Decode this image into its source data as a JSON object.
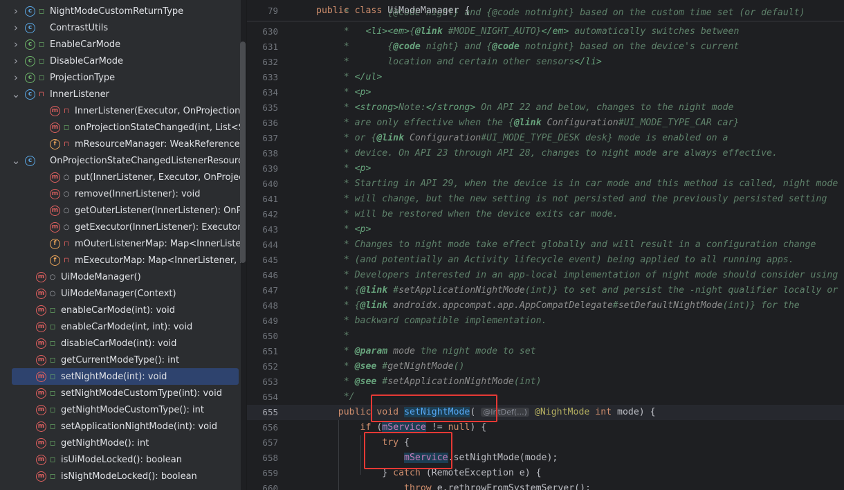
{
  "structure": {
    "items": [
      {
        "indent": 1,
        "toggle": "›",
        "icon": "c",
        "vis": "pub",
        "label": "NightModeCustomReturnType",
        "icon_name": "annotation-type-icon"
      },
      {
        "indent": 1,
        "toggle": "›",
        "icon": "c",
        "vis": "",
        "label": "ContrastUtils",
        "icon_name": "class-icon"
      },
      {
        "indent": 1,
        "toggle": "›",
        "icon": "e",
        "vis": "pub",
        "label": "EnableCarMode",
        "icon_name": "annotation-type-icon"
      },
      {
        "indent": 1,
        "toggle": "›",
        "icon": "e",
        "vis": "pub",
        "label": "DisableCarMode",
        "icon_name": "annotation-type-icon"
      },
      {
        "indent": 1,
        "toggle": "›",
        "icon": "e",
        "vis": "pub",
        "label": "ProjectionType",
        "icon_name": "annotation-type-icon"
      },
      {
        "indent": 1,
        "toggle": "⌄",
        "icon": "c",
        "vis": "priv",
        "label": "InnerListener",
        "icon_name": "class-icon"
      },
      {
        "indent": 3,
        "toggle": "",
        "icon": "m",
        "vis": "priv",
        "label": "InnerListener(Executor, OnProjectionStateC",
        "icon_name": "method-icon"
      },
      {
        "indent": 3,
        "toggle": "",
        "icon": "m",
        "vis": "pub",
        "label": "onProjectionStateChanged(int, List<String>",
        "icon_name": "method-icon"
      },
      {
        "indent": 3,
        "toggle": "",
        "icon": "f",
        "vis": "priv",
        "label": "mResourceManager: WeakReference<OnP",
        "icon_name": "field-icon"
      },
      {
        "indent": 1,
        "toggle": "⌄",
        "icon": "c",
        "vis": "",
        "label": "OnProjectionStateChangedListenerResourceM",
        "icon_name": "class-icon"
      },
      {
        "indent": 3,
        "toggle": "",
        "icon": "m",
        "vis": "pkg",
        "label": "put(InnerListener, Executor, OnProjectionSt",
        "icon_name": "method-icon"
      },
      {
        "indent": 3,
        "toggle": "",
        "icon": "m",
        "vis": "pkg",
        "label": "remove(InnerListener): void",
        "icon_name": "method-icon"
      },
      {
        "indent": 3,
        "toggle": "",
        "icon": "m",
        "vis": "pkg",
        "label": "getOuterListener(InnerListener): OnProjecti",
        "icon_name": "method-icon"
      },
      {
        "indent": 3,
        "toggle": "",
        "icon": "m",
        "vis": "pkg",
        "label": "getExecutor(InnerListener): Executor",
        "icon_name": "method-icon"
      },
      {
        "indent": 3,
        "toggle": "",
        "icon": "f",
        "vis": "priv",
        "label": "mOuterListenerMap: Map<InnerListener, C",
        "icon_name": "field-icon"
      },
      {
        "indent": 3,
        "toggle": "",
        "icon": "f",
        "vis": "priv",
        "label": "mExecutorMap: Map<InnerListener, Execu",
        "icon_name": "field-icon"
      },
      {
        "indent": 2,
        "toggle": "",
        "icon": "m",
        "vis": "pkg",
        "label": "UiModeManager()",
        "icon_name": "method-icon"
      },
      {
        "indent": 2,
        "toggle": "",
        "icon": "m",
        "vis": "pkg",
        "label": "UiModeManager(Context)",
        "icon_name": "method-icon"
      },
      {
        "indent": 2,
        "toggle": "",
        "icon": "m",
        "vis": "pub",
        "label": "enableCarMode(int): void",
        "icon_name": "method-icon"
      },
      {
        "indent": 2,
        "toggle": "",
        "icon": "m",
        "vis": "pub",
        "label": "enableCarMode(int, int): void",
        "icon_name": "method-icon"
      },
      {
        "indent": 2,
        "toggle": "",
        "icon": "m",
        "vis": "pub",
        "label": "disableCarMode(int): void",
        "icon_name": "method-icon"
      },
      {
        "indent": 2,
        "toggle": "",
        "icon": "m",
        "vis": "pub",
        "label": "getCurrentModeType(): int",
        "icon_name": "method-icon"
      },
      {
        "indent": 2,
        "toggle": "",
        "icon": "m",
        "vis": "pub",
        "label": "setNightMode(int): void",
        "icon_name": "method-icon",
        "selected": true
      },
      {
        "indent": 2,
        "toggle": "",
        "icon": "m",
        "vis": "pub",
        "label": "setNightModeCustomType(int): void",
        "icon_name": "method-icon"
      },
      {
        "indent": 2,
        "toggle": "",
        "icon": "m",
        "vis": "pub",
        "label": "getNightModeCustomType(): int",
        "icon_name": "method-icon"
      },
      {
        "indent": 2,
        "toggle": "",
        "icon": "m",
        "vis": "pub",
        "label": "setApplicationNightMode(int): void",
        "icon_name": "method-icon"
      },
      {
        "indent": 2,
        "toggle": "",
        "icon": "m",
        "vis": "pub",
        "label": "getNightMode(): int",
        "icon_name": "method-icon"
      },
      {
        "indent": 2,
        "toggle": "",
        "icon": "m",
        "vis": "pub",
        "label": "isUiModeLocked(): boolean",
        "icon_name": "method-icon"
      },
      {
        "indent": 2,
        "toggle": "",
        "icon": "m",
        "vis": "pub",
        "label": "isNightModeLocked(): boolean",
        "icon_name": "method-icon"
      }
    ]
  },
  "editor": {
    "sticky": {
      "line": "79",
      "keyword1": "public",
      "keyword2": "class",
      "name": "UiModeManager",
      "brace": "{"
    },
    "lines": [
      {
        "n": "630",
        "segs": [
          [
            "c",
            "     *   "
          ],
          [
            "ct",
            "<li><em>"
          ],
          [
            "c",
            "{"
          ],
          [
            "cb",
            "@link"
          ],
          [
            "c",
            " #MODE_NIGHT_AUTO}"
          ],
          [
            "ct",
            "</em>"
          ],
          [
            "c",
            " automatically switches between"
          ]
        ]
      },
      {
        "n": "631",
        "segs": [
          [
            "c",
            "     *       {"
          ],
          [
            "cb",
            "@code"
          ],
          [
            "c",
            " night} and {"
          ],
          [
            "cb",
            "@code"
          ],
          [
            "c",
            " notnight} based on the device's current"
          ]
        ]
      },
      {
        "n": "632",
        "segs": [
          [
            "c",
            "     *       location and certain other sensors"
          ],
          [
            "ct",
            "</li>"
          ]
        ]
      },
      {
        "n": "633",
        "segs": [
          [
            "c",
            "     * "
          ],
          [
            "ct",
            "</ul>"
          ]
        ]
      },
      {
        "n": "634",
        "segs": [
          [
            "c",
            "     * "
          ],
          [
            "ct",
            "<p>"
          ]
        ]
      },
      {
        "n": "635",
        "segs": [
          [
            "c",
            "     * "
          ],
          [
            "ct",
            "<strong>"
          ],
          [
            "c",
            "Note:"
          ],
          [
            "ct",
            "</strong>"
          ],
          [
            "c",
            " On API 22 and below, changes to the night mode"
          ]
        ]
      },
      {
        "n": "636",
        "segs": [
          [
            "c",
            "     * are only effective when the {"
          ],
          [
            "cb",
            "@link"
          ],
          [
            "cl",
            " Configuration"
          ],
          [
            "c",
            "#UI_MODE_TYPE_CAR car}"
          ]
        ]
      },
      {
        "n": "637",
        "segs": [
          [
            "c",
            "     * or {"
          ],
          [
            "cb",
            "@link"
          ],
          [
            "cl",
            " Configuration"
          ],
          [
            "c",
            "#UI_MODE_TYPE_DESK desk} mode is enabled on a"
          ]
        ]
      },
      {
        "n": "638",
        "segs": [
          [
            "c",
            "     * device. On API 23 through API 28, changes to night mode are always effective."
          ]
        ]
      },
      {
        "n": "639",
        "segs": [
          [
            "c",
            "     * "
          ],
          [
            "ct",
            "<p>"
          ]
        ]
      },
      {
        "n": "640",
        "segs": [
          [
            "c",
            "     * Starting in API 29, when the device is in car mode and this method is called, night mode"
          ]
        ]
      },
      {
        "n": "641",
        "segs": [
          [
            "c",
            "     * will change, but the new setting is not persisted and the previously persisted setting"
          ]
        ]
      },
      {
        "n": "642",
        "segs": [
          [
            "c",
            "     * will be restored when the device exits car mode."
          ]
        ]
      },
      {
        "n": "643",
        "segs": [
          [
            "c",
            "     * "
          ],
          [
            "ct",
            "<p>"
          ]
        ]
      },
      {
        "n": "644",
        "segs": [
          [
            "c",
            "     * Changes to night mode take effect globally and will result in a configuration change"
          ]
        ]
      },
      {
        "n": "645",
        "segs": [
          [
            "c",
            "     * (and potentially an Activity lifecycle event) being applied to all running apps."
          ]
        ]
      },
      {
        "n": "646",
        "segs": [
          [
            "c",
            "     * Developers interested in an app-local implementation of night mode should consider using"
          ]
        ]
      },
      {
        "n": "647",
        "segs": [
          [
            "c",
            "     * {"
          ],
          [
            "cb",
            "@link"
          ],
          [
            "c",
            " #"
          ],
          [
            "cl",
            "setApplicationNightMode"
          ],
          [
            "c",
            "(int)} to set and persist the -night qualifier locally or"
          ]
        ]
      },
      {
        "n": "648",
        "segs": [
          [
            "c",
            "     * {"
          ],
          [
            "cb",
            "@link"
          ],
          [
            "cl",
            " androidx.appcompat.app.AppCompatDelegate"
          ],
          [
            "c",
            "#"
          ],
          [
            "cl",
            "setDefaultNightMode"
          ],
          [
            "c",
            "(int)} for the"
          ]
        ]
      },
      {
        "n": "649",
        "segs": [
          [
            "c",
            "     * backward compatible implementation."
          ]
        ]
      },
      {
        "n": "650",
        "segs": [
          [
            "c",
            "     *"
          ]
        ]
      },
      {
        "n": "651",
        "segs": [
          [
            "c",
            "     * "
          ],
          [
            "cb",
            "@param"
          ],
          [
            "cl",
            " mode"
          ],
          [
            "c",
            " the night mode to set"
          ]
        ]
      },
      {
        "n": "652",
        "segs": [
          [
            "c",
            "     * "
          ],
          [
            "cb",
            "@see"
          ],
          [
            "c",
            " #"
          ],
          [
            "cl",
            "getNightMode"
          ],
          [
            "c",
            "()"
          ]
        ]
      },
      {
        "n": "653",
        "segs": [
          [
            "c",
            "     * "
          ],
          [
            "cb",
            "@see"
          ],
          [
            "c",
            " #"
          ],
          [
            "cl",
            "setApplicationNightMode"
          ],
          [
            "c",
            "(int)"
          ]
        ]
      },
      {
        "n": "654",
        "segs": [
          [
            "c",
            "     */"
          ]
        ]
      },
      {
        "n": "655",
        "current": true,
        "segs": [
          [
            "pl",
            "    "
          ],
          [
            "kw",
            "public"
          ],
          [
            "pl",
            " "
          ],
          [
            "kw",
            "void"
          ],
          [
            "pl",
            " "
          ],
          [
            "fn hl",
            "setNightMode"
          ],
          [
            "pl",
            "( "
          ],
          [
            "inlay",
            "@IntDef(...)"
          ],
          [
            "pl",
            " "
          ],
          [
            "an",
            "@NightMode"
          ],
          [
            "pl",
            " "
          ],
          [
            "kw",
            "int"
          ],
          [
            "pl",
            " mode) {"
          ]
        ]
      },
      {
        "n": "656",
        "segs": [
          [
            "pl",
            "        "
          ],
          [
            "kw",
            "if"
          ],
          [
            "pl",
            " ("
          ],
          [
            "fld hl",
            "mService"
          ],
          [
            "pl",
            " != "
          ],
          [
            "kw",
            "null"
          ],
          [
            "pl",
            ") {"
          ]
        ]
      },
      {
        "n": "657",
        "segs": [
          [
            "pl",
            "            "
          ],
          [
            "kw",
            "try"
          ],
          [
            "pl",
            " {"
          ]
        ]
      },
      {
        "n": "658",
        "segs": [
          [
            "pl",
            "                "
          ],
          [
            "fld hl",
            "mService"
          ],
          [
            "pl",
            ".setNightMode(mode);"
          ]
        ]
      },
      {
        "n": "659",
        "segs": [
          [
            "pl",
            "            } "
          ],
          [
            "kw",
            "catch"
          ],
          [
            "pl",
            " (RemoteException e) {"
          ]
        ]
      },
      {
        "n": "660",
        "segs": [
          [
            "pl",
            "                "
          ],
          [
            "kw",
            "throw"
          ],
          [
            "pl",
            " e.rethrowFromSystemServer();"
          ]
        ]
      }
    ]
  },
  "colors": {
    "accent_selection": "#2e436e",
    "highlight_box": "#e53935"
  }
}
